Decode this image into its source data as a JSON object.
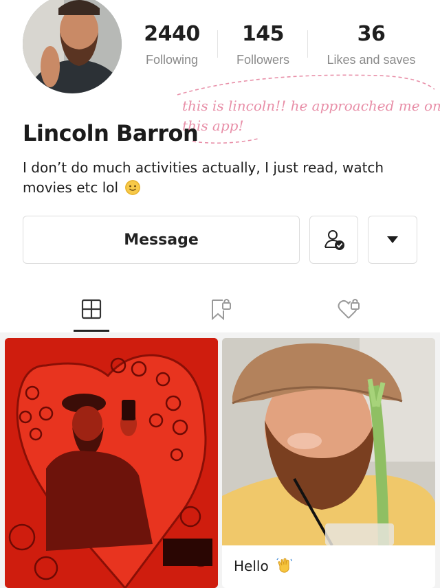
{
  "profile": {
    "name": "Lincoln Barron",
    "bio": "I don’t do much activities actually, I just read, watch movies etc lol"
  },
  "stats": [
    {
      "value": "2440",
      "label": "Following"
    },
    {
      "value": "145",
      "label": "Followers"
    },
    {
      "value": "36",
      "label": "Likes and saves"
    }
  ],
  "annotation": {
    "line1": "this is lincoln!! he approached me on",
    "line2": "this app!",
    "color": "#e88fa8"
  },
  "actions": {
    "message_label": "Message",
    "follow_icon": "person-check-icon",
    "more_icon": "caret-down-icon"
  },
  "tabs": [
    {
      "icon": "grid-icon",
      "active": true
    },
    {
      "icon": "bookmark-lock-icon",
      "active": false
    },
    {
      "icon": "heart-lock-icon",
      "active": false
    }
  ],
  "posts": [
    {
      "title": ""
    },
    {
      "title": "Hello"
    }
  ]
}
